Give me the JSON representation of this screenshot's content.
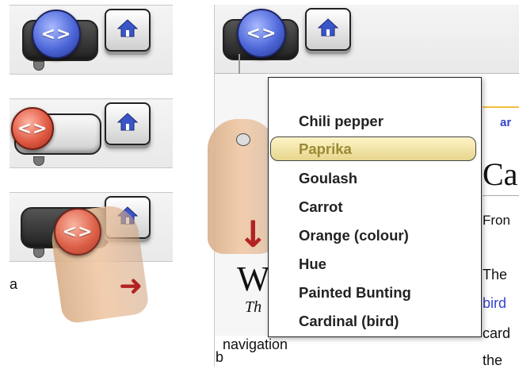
{
  "panel_labels": {
    "a": "a",
    "b": "b"
  },
  "icons": {
    "nav_arrows": "<>",
    "home": "home-icon",
    "pointer_arrow_right": "➜",
    "pointer_arrow_down": "↓"
  },
  "colors": {
    "blue_knob": "#4d67d8",
    "red_knob": "#e05a43",
    "highlight": "#e6d58c",
    "link_blue": "#3344cc",
    "arrow_red": "#b22222"
  },
  "dropdown": {
    "items": [
      "Chili pepper",
      "Paprika",
      "Goulash",
      "Carrot",
      "Orange (colour)",
      "Hue",
      "Painted Bunting",
      "Cardinal (bird)"
    ],
    "highlighted_item": "Paprika"
  },
  "wiki": {
    "tab_fragment": "ar",
    "title_fragment": "Ca",
    "from_fragment": "Fron",
    "body_lines": [
      "The",
      "bird",
      "card",
      "the"
    ],
    "logo_letter": "W",
    "logo_sub": "Th",
    "nav_label": "navigation"
  }
}
